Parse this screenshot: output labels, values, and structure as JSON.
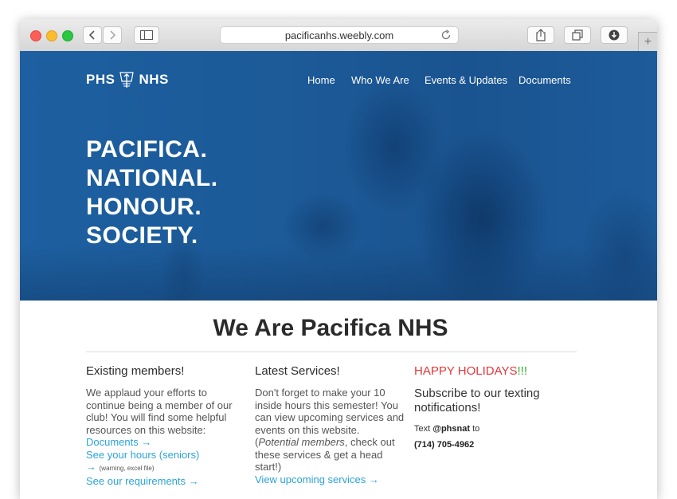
{
  "browser": {
    "url": "pacificanhs.weebly.com",
    "new_tab": "+"
  },
  "site": {
    "logo_left": "PHS",
    "logo_right": "NHS",
    "nav": [
      "Home",
      "Who We Are",
      "Events & Updates",
      "Documents"
    ],
    "hero_lines": [
      "PACIFICA.",
      "NATIONAL.",
      "HONOUR.",
      "SOCIETY."
    ]
  },
  "main": {
    "heading": "We Are Pacifica NHS",
    "col1": {
      "title": "Existing members!",
      "body": "We applaud your efforts to continue being a member of our club! You will find some helpful resources on this website:",
      "link_documents": "Documents →",
      "link_hours": "See your hours (seniors)",
      "arrow": "→",
      "note": "(warning, excel file)",
      "link_requirements": "See our requirements →"
    },
    "col2": {
      "title": "Latest Services!",
      "body_1": "Don't forget to make your 10 inside hours this semester! You can view upcoming services and events on this website. (",
      "body_em": "Potential members",
      "body_2": ", check out these services & get a head start!)",
      "link_services": "View upcoming services →"
    },
    "col3": {
      "title_red": "HAPPY HOLIDAYS",
      "title_green": "!!!",
      "subtitle": "Subscribe to our texting notifications!",
      "text_prefix": "Text ",
      "handle": "@phsnat",
      "text_suffix": " to",
      "phone": "(714) 705-4962"
    }
  },
  "colors": {
    "hero_blue": "#1c5a98",
    "link": "#2ba3d9",
    "holiday_red": "#e2383a",
    "holiday_green": "#36b233"
  }
}
